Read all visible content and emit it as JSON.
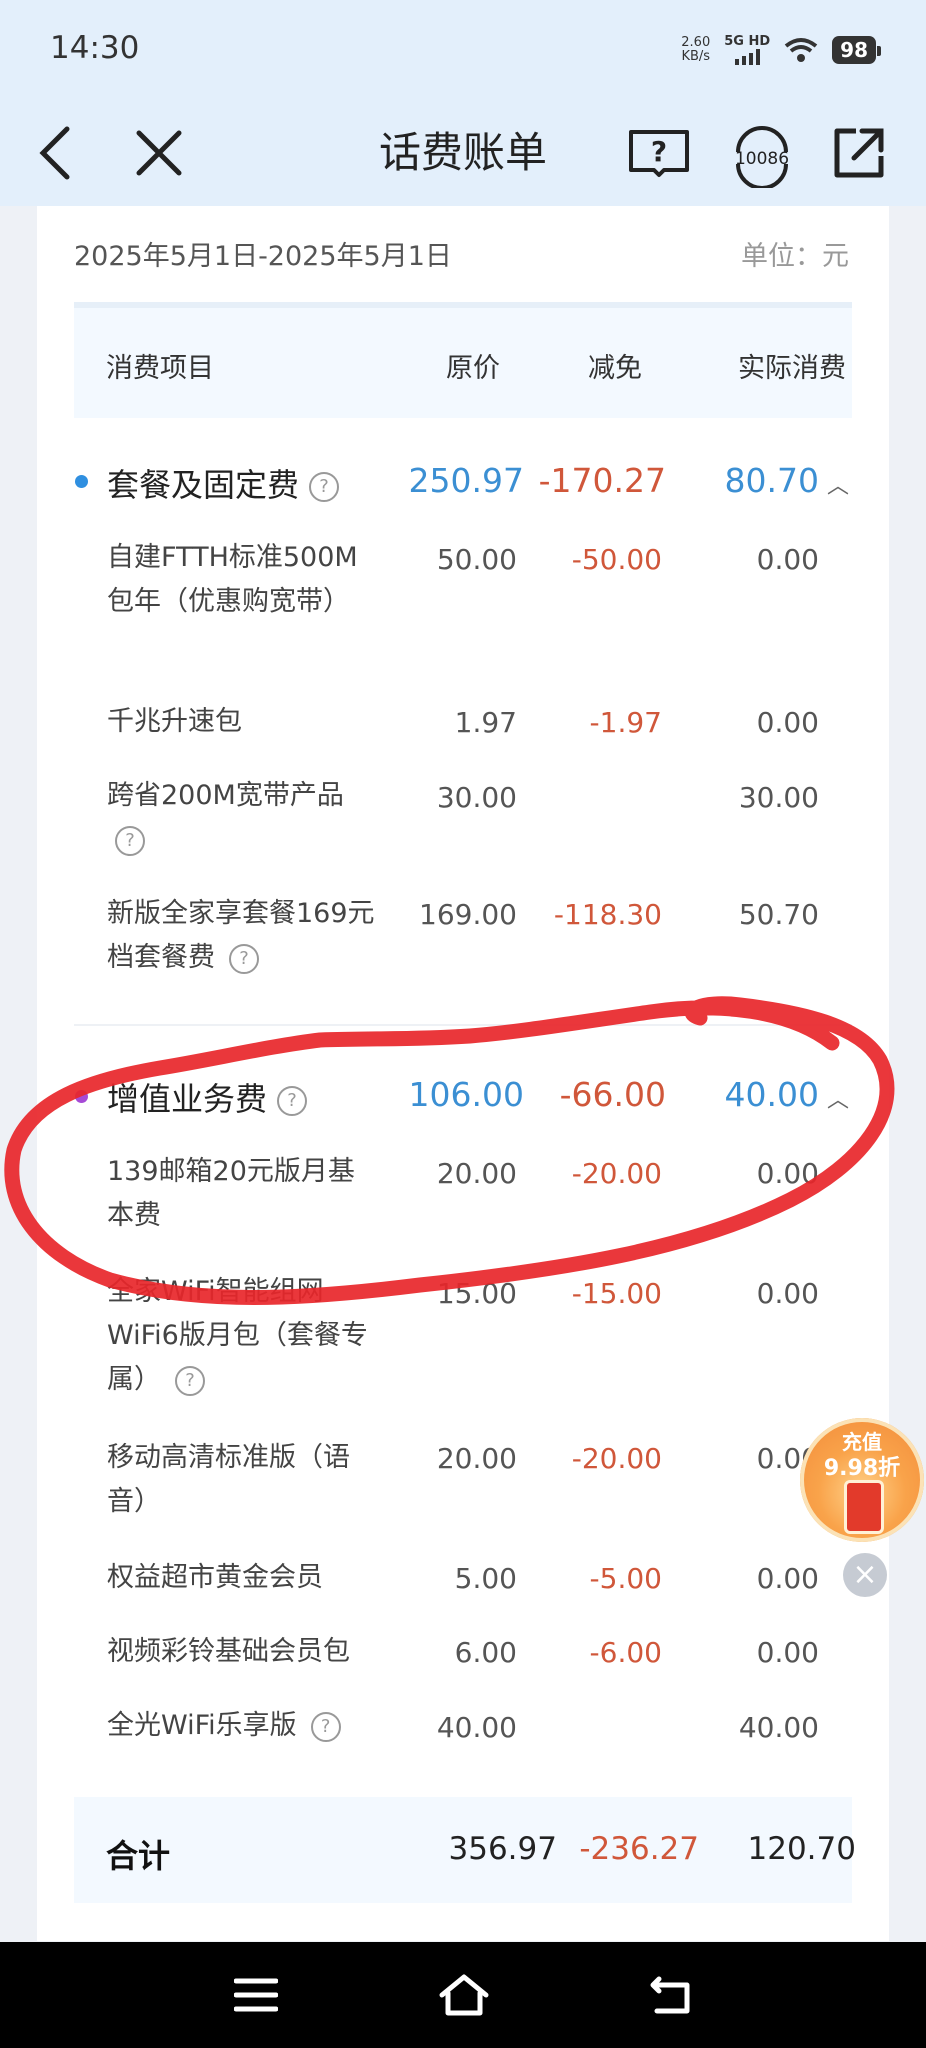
{
  "status_bar": {
    "time": "14:30",
    "net_speed_value": "2.60",
    "net_speed_unit": "KB/s",
    "signal_label": "5G HD",
    "battery": "98"
  },
  "header": {
    "title": "话费账单",
    "hotline_number": "10086"
  },
  "bill": {
    "date_range": "2025年5月1日-2025年5月1日",
    "unit": "单位：元",
    "columns": [
      "消费项目",
      "原价",
      "减免",
      "实际消费"
    ],
    "categories": [
      {
        "name": "套餐及固定费",
        "dot_color": "#2f8fe0",
        "orig": "250.97",
        "disc": "-170.27",
        "real": "80.70",
        "items": [
          {
            "name": "自建FTTH标准500M包年（优惠购宽带）",
            "orig": "50.00",
            "disc": "-50.00",
            "real": "0.00"
          },
          {
            "name": "千兆升速包",
            "orig": "1.97",
            "disc": "-1.97",
            "real": "0.00"
          },
          {
            "name": "跨省200M宽带产品",
            "orig": "30.00",
            "disc": "",
            "real": "30.00"
          },
          {
            "name": "新版全家享套餐169元档套餐费",
            "orig": "169.00",
            "disc": "-118.30",
            "real": "50.70"
          }
        ]
      },
      {
        "name": "增值业务费",
        "dot_color": "#a64ad6",
        "orig": "106.00",
        "disc": "-66.00",
        "real": "40.00",
        "items": [
          {
            "name": "139邮箱20元版月基本费",
            "orig": "20.00",
            "disc": "-20.00",
            "real": "0.00"
          },
          {
            "name": "全家WiFi智能组网WiFi6版月包（套餐专属）",
            "orig": "15.00",
            "disc": "-15.00",
            "real": "0.00"
          },
          {
            "name": "移动高清标准版（语音）",
            "orig": "20.00",
            "disc": "-20.00",
            "real": "0.00"
          },
          {
            "name": "权益超市黄金会员",
            "orig": "5.00",
            "disc": "-5.00",
            "real": "0.00"
          },
          {
            "name": "视频彩铃基础会员包",
            "orig": "6.00",
            "disc": "-6.00",
            "real": "0.00"
          },
          {
            "name": "全光WiFi乐享版",
            "orig": "40.00",
            "disc": "",
            "real": "40.00"
          }
        ]
      }
    ],
    "total": {
      "label": "合计",
      "orig": "356.97",
      "disc": "-236.27",
      "real": "120.70"
    }
  },
  "promo": {
    "line1": "充值",
    "line2": "9.98折"
  },
  "colors": {
    "accent_blue": "#3b8fd3",
    "discount_red": "#d0573a",
    "annotation_red": "#e8262a"
  }
}
